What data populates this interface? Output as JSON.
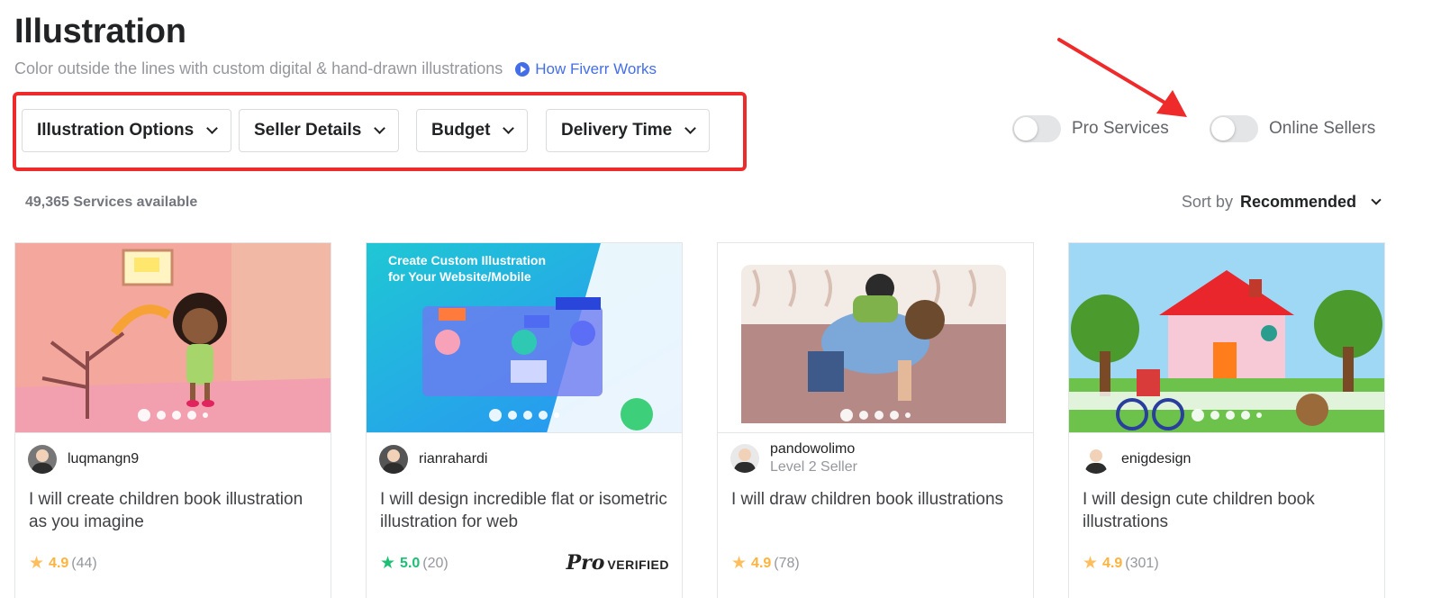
{
  "header": {
    "title": "Illustration",
    "subtitle": "Color outside the lines with custom digital & hand-drawn illustrations",
    "how_link": "How Fiverr Works"
  },
  "filters": [
    "Illustration Options",
    "Seller Details",
    "Budget",
    "Delivery Time"
  ],
  "toggles": {
    "pro_services": {
      "label": "Pro Services",
      "on": false
    },
    "online_sellers": {
      "label": "Online Sellers",
      "on": false
    }
  },
  "results": {
    "count": "49,365 Services available",
    "sort_label": "Sort by",
    "sort_value": "Recommended"
  },
  "cards": [
    {
      "seller": "luqmangn9",
      "level": "",
      "title": "I will create children book illustration as you imagine",
      "rating": "4.9",
      "reviews": "(44)",
      "pro": false
    },
    {
      "seller": "rianrahardi",
      "level": "",
      "title": "I will design incredible flat or isometric illustration for web",
      "rating": "5.0",
      "reviews": "(20)",
      "pro": true,
      "pro_mark": "Pro",
      "pro_text": "VERIFIED",
      "image_caption": "Create Custom Illustration for Your Website/Mobile"
    },
    {
      "seller": "pandowolimo",
      "level": "Level 2 Seller",
      "title": "I will draw children book illustrations",
      "rating": "4.9",
      "reviews": "(78)",
      "pro": false
    },
    {
      "seller": "enigdesign",
      "level": "",
      "title": "I will design cute children book illustrations",
      "rating": "4.9",
      "reviews": "(301)",
      "pro": false
    }
  ],
  "colors": {
    "annotation_red": "#ee2a2a",
    "link_blue": "#446ee7",
    "star_yellow": "#ffbe5b",
    "pro_green": "#1dbf73"
  }
}
